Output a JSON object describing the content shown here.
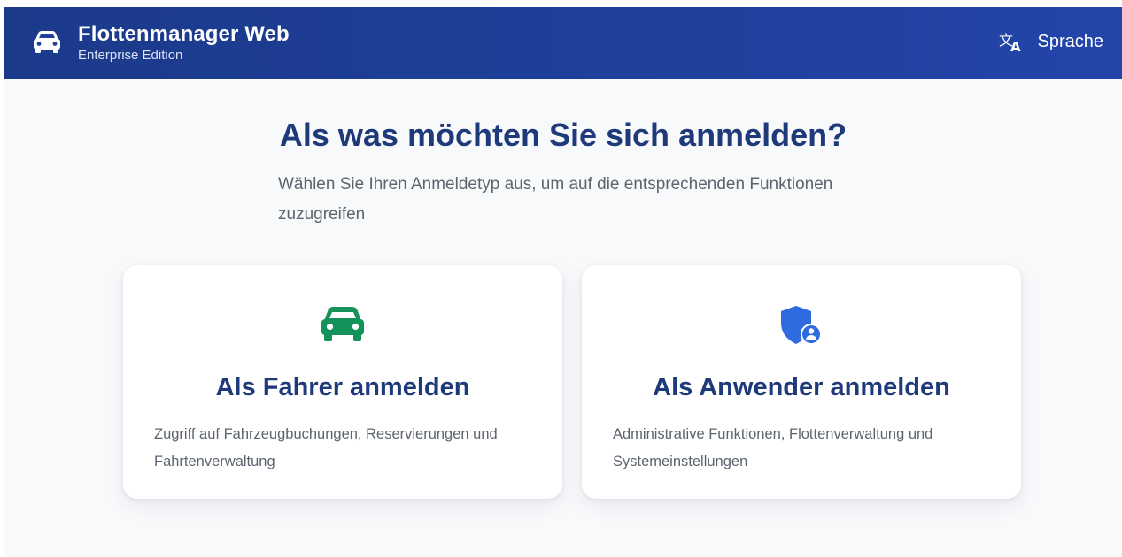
{
  "header": {
    "brand_icon": "car-icon",
    "title": "Flottenmanager Web",
    "subtitle": "Enterprise Edition",
    "language_icon": "translate-icon",
    "language_label": "Sprache",
    "background_color": "#1f3f9a"
  },
  "main": {
    "heading": "Als was möchten Sie sich anmelden?",
    "description": "Wählen Sie Ihren Anmeldetyp aus, um auf die entsprechenden Funktionen zuzugreifen"
  },
  "cards": [
    {
      "icon": "car-icon",
      "icon_color": "#13935a",
      "title": "Als Fahrer anmelden",
      "description": "Zugriff auf Fahrzeugbuchungen, Reservierungen und Fahrtenverwaltung"
    },
    {
      "icon": "shield-user-icon",
      "icon_color": "#2f6be0",
      "title": "Als Anwender anmelden",
      "description": "Administrative Funktionen, Flottenverwaltung und Systemeinstellungen"
    }
  ],
  "colors": {
    "heading": "#1f3a7a",
    "body_text": "#5c6470",
    "page_background": "#f8f9fb"
  }
}
